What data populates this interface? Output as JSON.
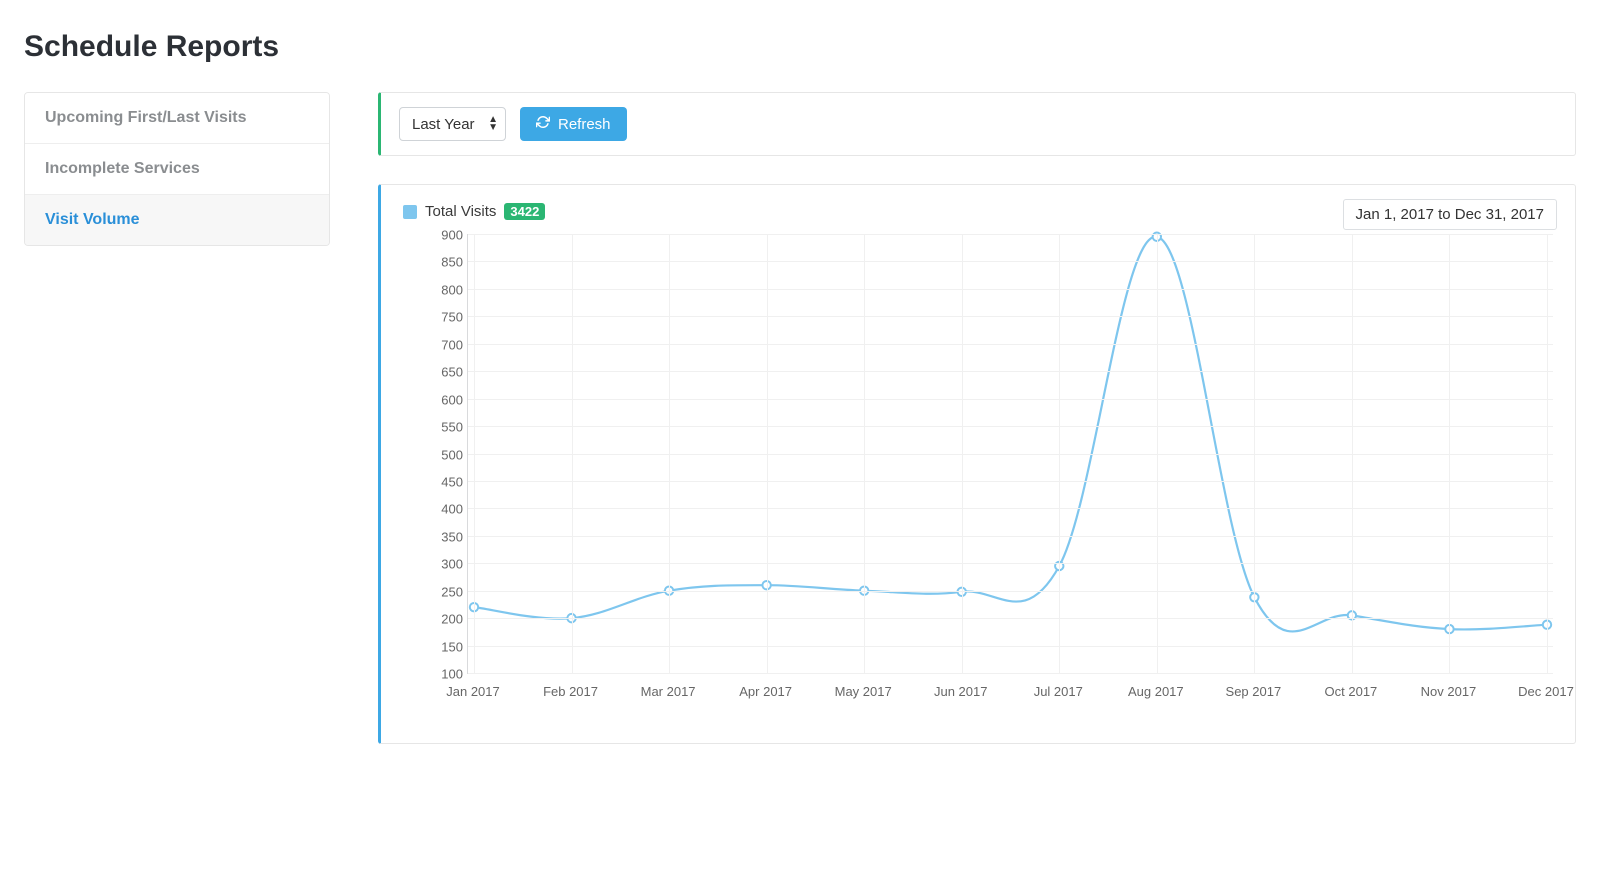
{
  "page_title": "Schedule Reports",
  "sidebar": {
    "items": [
      {
        "label": "Upcoming First/Last Visits",
        "active": false
      },
      {
        "label": "Incomplete Services",
        "active": false
      },
      {
        "label": "Visit Volume",
        "active": true
      }
    ]
  },
  "toolbar": {
    "range_select": {
      "value": "Last Year"
    },
    "refresh_label": "Refresh"
  },
  "chart": {
    "legend_label": "Total Visits",
    "total_badge": "3422",
    "date_range": "Jan 1, 2017 to Dec 31, 2017",
    "series_color": "#7ec6ee"
  },
  "chart_data": {
    "type": "line",
    "title": "",
    "xlabel": "",
    "ylabel": "",
    "ylim": [
      100,
      900
    ],
    "y_ticks": [
      100,
      150,
      200,
      250,
      300,
      350,
      400,
      450,
      500,
      550,
      600,
      650,
      700,
      750,
      800,
      850,
      900
    ],
    "categories": [
      "Jan 2017",
      "Feb 2017",
      "Mar 2017",
      "Apr 2017",
      "May 2017",
      "Jun 2017",
      "Jul 2017",
      "Aug 2017",
      "Sep 2017",
      "Oct 2017",
      "Nov 2017",
      "Dec 2017"
    ],
    "series": [
      {
        "name": "Total Visits",
        "values": [
          220,
          200,
          250,
          260,
          250,
          248,
          295,
          895,
          238,
          205,
          180,
          188
        ]
      }
    ],
    "legend_position": "top-left",
    "grid": true
  }
}
